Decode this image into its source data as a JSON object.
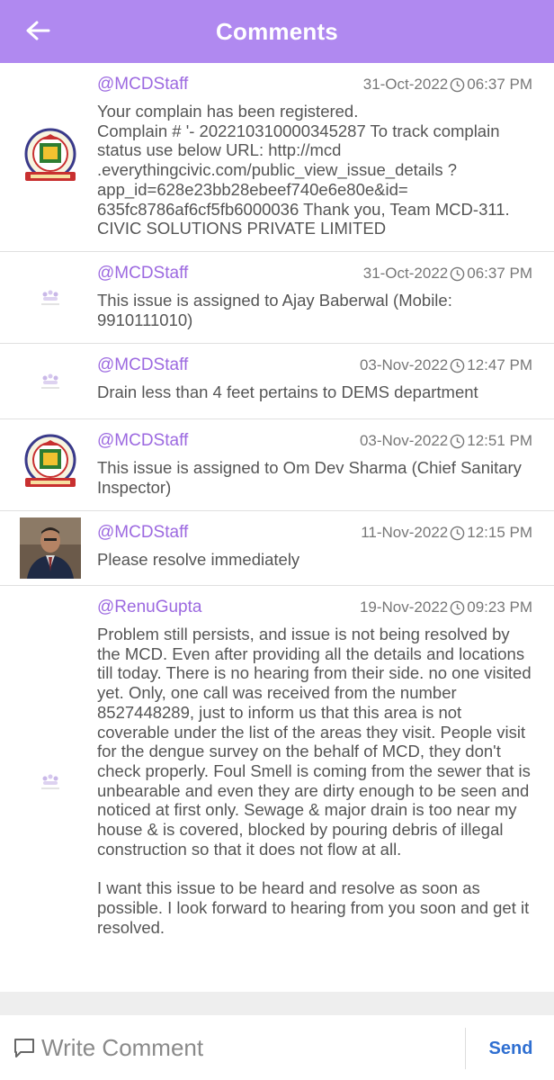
{
  "header": {
    "title": "Comments",
    "back_icon": "arrow-left-icon"
  },
  "comments": [
    {
      "author": "@MCDStaff",
      "date": "31-Oct-2022",
      "time": "06:37 PM",
      "avatar": "mcd-emblem",
      "text": "Your complain has been registered.\nComplain # '- 202210310000345287 To track complain status use below URL: http://mcd .everythingcivic.com/public_view_issue_details ?app_id=628e23bb28ebeef740e6e80e&id= 635fc8786af6cf5fb6000036 Thank you, Team MCD-311. CIVIC SOLUTIONS PRIVATE LIMITED"
    },
    {
      "author": "@MCDStaff",
      "date": "31-Oct-2022",
      "time": "06:37 PM",
      "avatar": "placeholder-logo",
      "text": "This issue is assigned to Ajay Baberwal  (Mobile: 9910111010)"
    },
    {
      "author": "@MCDStaff",
      "date": "03-Nov-2022",
      "time": "12:47 PM",
      "avatar": "placeholder-logo",
      "text": "Drain less than 4 feet pertains to DEMS department"
    },
    {
      "author": "@MCDStaff",
      "date": "03-Nov-2022",
      "time": "12:51 PM",
      "avatar": "mcd-emblem",
      "text": "This issue is assigned to Om Dev Sharma (Chief Sanitary Inspector)"
    },
    {
      "author": "@MCDStaff",
      "date": "11-Nov-2022",
      "time": "12:15 PM",
      "avatar": "user-photo",
      "text": "Please resolve immediately"
    },
    {
      "author": "@RenuGupta",
      "date": "19-Nov-2022",
      "time": "09:23 PM",
      "avatar": "placeholder-logo",
      "text": "Problem still persists, and issue is not being resolved by the MCD. Even after providing all the details and locations till today. There is no hearing from their side. no one visited yet. Only, one call was received from the number 8527448289, just to inform us that this area is not coverable under the list of the areas they visit. People visit for the dengue survey on the behalf of MCD, they don't check properly. Foul Smell is coming from the sewer that is unbearable and even they are dirty enough to be seen and noticed at first only. Sewage & major drain is too near my house & is covered,  blocked by pouring debris of illegal construction so that it does not flow at all.\n\nI want this issue to be heard and resolve as soon as possible. I look forward to hearing from you soon and get it resolved."
    }
  ],
  "composer": {
    "placeholder": "Write Comment",
    "value": "",
    "send_label": "Send",
    "icon": "comment-bubble-icon"
  },
  "colors": {
    "header_bg": "#b089f0",
    "author": "#9c69e0",
    "send": "#2f6fd1"
  }
}
